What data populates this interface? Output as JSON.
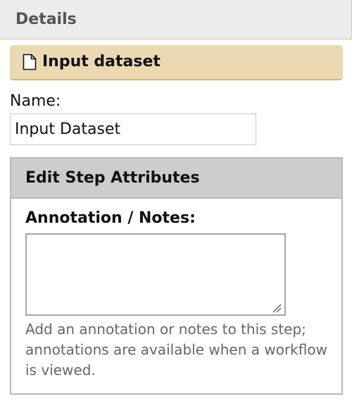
{
  "panel": {
    "title": "Details"
  },
  "node": {
    "title": "Input dataset",
    "icon": "document-icon"
  },
  "name_field": {
    "label": "Name:",
    "value": "Input Dataset"
  },
  "step_attributes": {
    "legend": "Edit Step Attributes",
    "annotation": {
      "label": "Annotation / Notes:",
      "value": "",
      "help": "Add an annotation or notes to this step; annotations are available when a workflow is viewed."
    }
  },
  "colors": {
    "node_title_bg": "#ebd9b2",
    "legend_bg": "#cdcdcd",
    "help_text": "#666666"
  }
}
